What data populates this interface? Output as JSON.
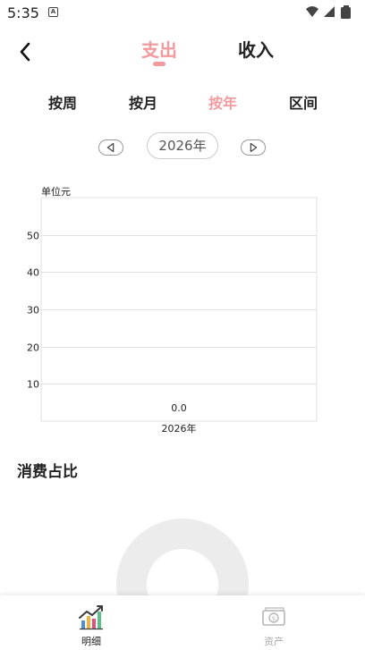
{
  "status_bar": {
    "time": "5:35",
    "notification_badge": "A"
  },
  "header": {
    "tabs": [
      {
        "label": "支出",
        "active": true
      },
      {
        "label": "收入",
        "active": false
      }
    ],
    "accent_color": "#f29b9f"
  },
  "period_tabs": [
    {
      "label": "按周",
      "active": false
    },
    {
      "label": "按月",
      "active": false
    },
    {
      "label": "按年",
      "active": true
    },
    {
      "label": "区间",
      "active": false
    }
  ],
  "year_selector": {
    "value": "2026年"
  },
  "chart_data": {
    "type": "bar",
    "unit_label": "单位元",
    "categories": [
      "2026年"
    ],
    "values": [
      0.0
    ],
    "data_labels": [
      "0.0"
    ],
    "y_ticks": [
      10,
      20,
      30,
      40,
      50
    ],
    "ylim": [
      0,
      60
    ],
    "grid": true
  },
  "section": {
    "title": "消费占比"
  },
  "bottom_nav": [
    {
      "label": "明细",
      "icon": "chart-icon",
      "active": true
    },
    {
      "label": "资产",
      "icon": "money-icon",
      "active": false
    }
  ]
}
